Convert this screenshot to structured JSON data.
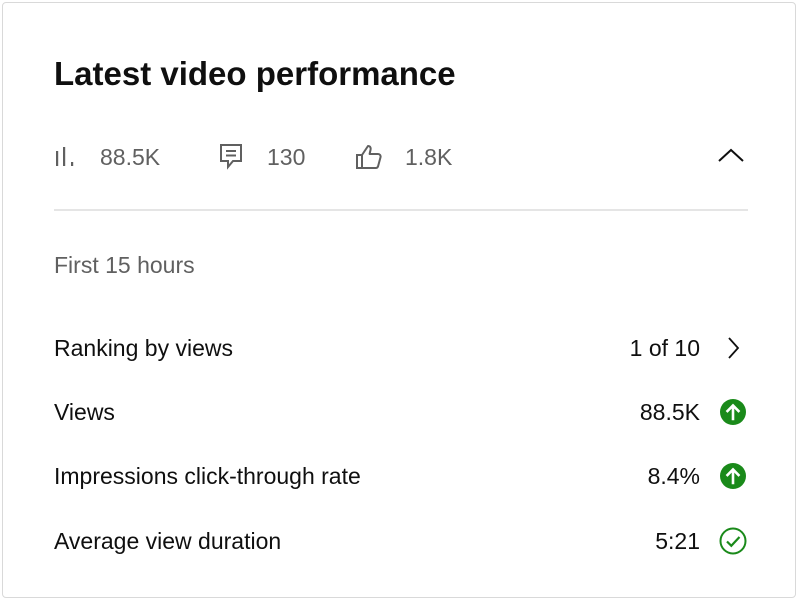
{
  "card": {
    "title": "Latest video performance"
  },
  "stats": {
    "views": {
      "icon": "bar-chart-icon",
      "value": "88.5K"
    },
    "comments": {
      "icon": "comment-icon",
      "value": "130"
    },
    "likes": {
      "icon": "thumbs-up-icon",
      "value": "1.8K"
    },
    "toggle_icon": "chevron-up-icon"
  },
  "period": "First 15 hours",
  "metrics": [
    {
      "label": "Ranking by views",
      "value": "1 of 10",
      "icon": "chevron-right-icon"
    },
    {
      "label": "Views",
      "value": "88.5K",
      "icon": "arrow-up-circle-icon"
    },
    {
      "label": "Impressions click-through rate",
      "value": "8.4%",
      "icon": "arrow-up-circle-icon"
    },
    {
      "label": "Average view duration",
      "value": "5:21",
      "icon": "check-circle-icon"
    }
  ],
  "colors": {
    "positive": "#1a8a1a",
    "text_primary": "#0f0f0f",
    "text_secondary": "#606060",
    "divider": "#e5e5e5"
  }
}
